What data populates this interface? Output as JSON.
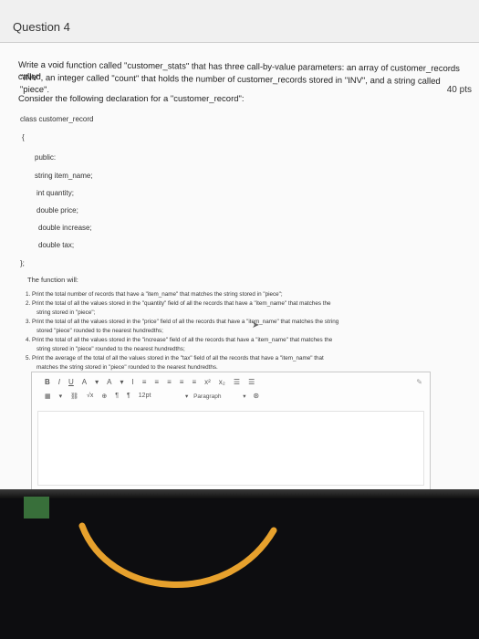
{
  "question": {
    "title": "Question 4",
    "points": "40 pts"
  },
  "prompt": {
    "line1": "Write a void function called \"customer_stats\" that has three call-by-value parameters: an array of customer_records called",
    "line2": "\"INV\", an integer called \"count\" that holds the number of customer_records stored in \"INV\", and a string called \"piece\".",
    "line3": "Consider the following declaration for a \"customer_record\":"
  },
  "code": {
    "line0": "class customer_record",
    "line1": "{",
    "line2": "public:",
    "line3": "string item_name;",
    "line4": "int quantity;",
    "line5": "double price;",
    "line6": "double increase;",
    "line7": "double tax;",
    "line8": "};"
  },
  "function_intro": "The function will:",
  "tasks": [
    "1. Print the total number of records that have a \"item_name\" that matches the string stored in \"piece\";",
    "2. Print the total of all the values stored in the \"quantity\" field of all the records that have a \"item_name\" that matches the",
    "string stored in \"piece\";",
    "3. Print the total of all the values stored in the \"price\" field of all the records that have a \"item_name\" that matches the string",
    "stored \"piece\" rounded to the nearest hundredths;",
    "4. Print the total of all the values stored in the \"increase\" field of all the records that have a \"item_name\" that matches the",
    "string stored in \"piece\" rounded to the nearest hundredths;",
    "5. Print the average of the total of all the values stored in the \"tax\" field of all the records that have a \"item_name\" that",
    "matches the string stored in \"piece\" rounded to the nearest hundredths."
  ],
  "toolbar": {
    "row1": [
      "B",
      "I",
      "U",
      "A",
      "▾",
      "A",
      "▾",
      "I",
      "≡",
      "≡",
      "≡",
      "≡",
      "≡",
      "x²",
      "x₂",
      "☰",
      "☰"
    ],
    "row2": [
      "▦",
      "▾",
      "⛓",
      "√x",
      "⊕",
      "¶",
      "¶",
      "12pt"
    ],
    "paragraph": "Paragraph",
    "paragraph_arrow": "▾",
    "corner": "✎"
  },
  "colors": {
    "screen_bg": "#f3f3f3",
    "header_bg": "#f0f0f0",
    "taskbar": "#0d0d10",
    "icon": "#3d7a3f"
  }
}
